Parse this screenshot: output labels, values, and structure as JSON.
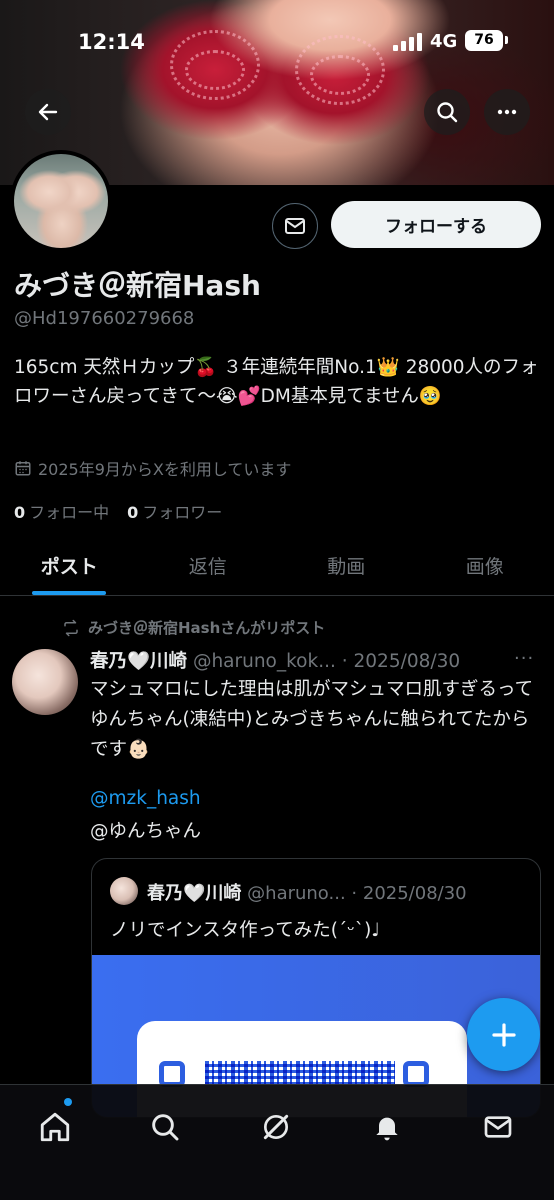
{
  "status_bar": {
    "time": "12:14",
    "network": "4G",
    "battery": "76"
  },
  "profile": {
    "display_name": "みづき＠新宿Hash",
    "handle": "@Hd197660279668",
    "bio": "165cm 天然Ｈカップ🍒 ３年連続年間No.1👑 28000人のフォロワーさん戻ってきて〜😭💕DM基本見てません🥹",
    "joined": "2025年9月からXを利用しています",
    "following_count": "0",
    "following_label": "フォロー中",
    "followers_count": "0",
    "followers_label": "フォロワー",
    "follow_button": "フォローする"
  },
  "tabs": [
    {
      "label": "ポスト",
      "active": true
    },
    {
      "label": "返信",
      "active": false
    },
    {
      "label": "動画",
      "active": false
    },
    {
      "label": "画像",
      "active": false
    }
  ],
  "post": {
    "repost_label": "みづき＠新宿Hashさんがリポスト",
    "author_name": "春乃🤍川崎",
    "author_handle": "@haruno_kok...",
    "date": "· 2025/08/30",
    "more": "···",
    "text": "マシュマロにした理由は肌がマシュマロ肌すぎるってゆんちゃん(凍結中)とみづきちゃんに触られてたからです👶🏻",
    "mention_link": "@mzk_hash",
    "mention_plain": "@ゆんちゃん",
    "quote": {
      "author_name": "春乃🤍川崎",
      "author_handle": "@haruno...",
      "date": "· 2025/08/30",
      "text": "ノリでインスタ作ってみた(ˊᵕˋ)♩"
    }
  },
  "colors": {
    "accent": "#1d9bf0",
    "background": "#000000",
    "secondary_text": "#71767b",
    "border": "#2f3336"
  },
  "icons": {
    "back": "arrow-left-icon",
    "search": "search-icon",
    "more": "more-horizontal-icon",
    "message": "envelope-icon",
    "calendar": "calendar-icon",
    "repost": "repost-icon",
    "compose": "plus-icon",
    "nav": [
      "home-icon",
      "search-icon",
      "grok-icon",
      "bell-icon",
      "envelope-icon"
    ]
  }
}
